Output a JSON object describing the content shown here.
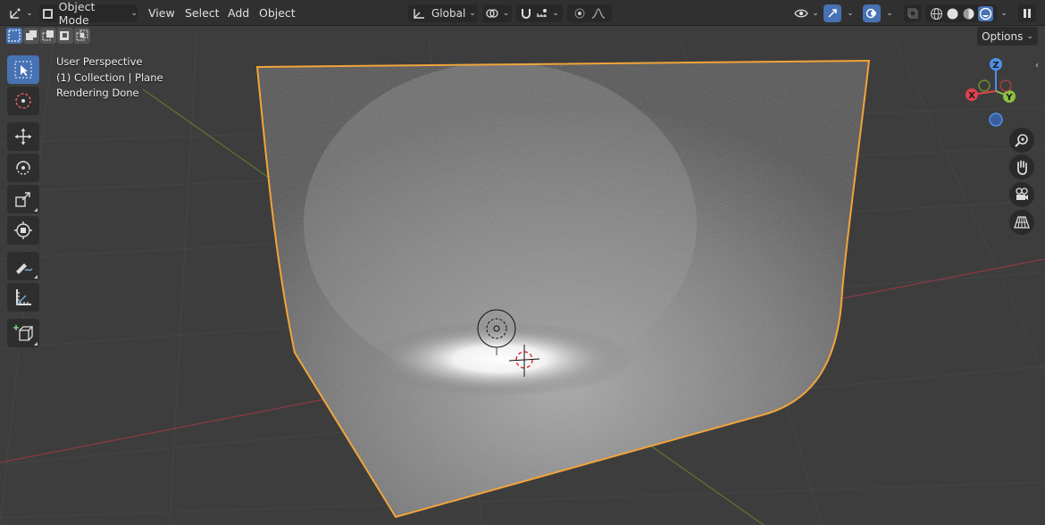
{
  "header": {
    "editor_type_icon": "axes-icon",
    "mode": "Object Mode",
    "menus": [
      "View",
      "Select",
      "Add",
      "Object"
    ],
    "transform_orientation": "Global"
  },
  "toolbar_secondary": {
    "options_label": "Options"
  },
  "viewport": {
    "info_lines": [
      "User Perspective",
      "(1) Collection | Plane",
      "Rendering Done"
    ],
    "selection_outline_color": "#f2a43a",
    "x_axis_color": "#a33c45",
    "y_axis_color": "#6e8a2f"
  },
  "gizmo": {
    "z_label": "Z",
    "x_label": "X",
    "y_label": "Y",
    "x_color": "#e0424f",
    "y_color": "#8bc043",
    "z_color": "#4f8fe6"
  },
  "left_tools": [
    {
      "name": "select-box-tool",
      "icon": "cursor-select-icon",
      "active": true
    },
    {
      "name": "cursor-tool",
      "icon": "3d-cursor-icon",
      "active": false
    },
    {
      "name": "move-tool",
      "icon": "move-arrows-icon",
      "active": false
    },
    {
      "name": "rotate-tool",
      "icon": "rotate-icon",
      "active": false
    },
    {
      "name": "scale-tool",
      "icon": "scale-icon",
      "active": false
    },
    {
      "name": "transform-tool",
      "icon": "transform-icon",
      "active": false
    },
    {
      "name": "annotate-tool",
      "icon": "annotate-pen-icon",
      "active": false
    },
    {
      "name": "measure-tool",
      "icon": "ruler-icon",
      "active": false
    },
    {
      "name": "add-cube-tool",
      "icon": "add-cube-icon",
      "active": false
    }
  ]
}
